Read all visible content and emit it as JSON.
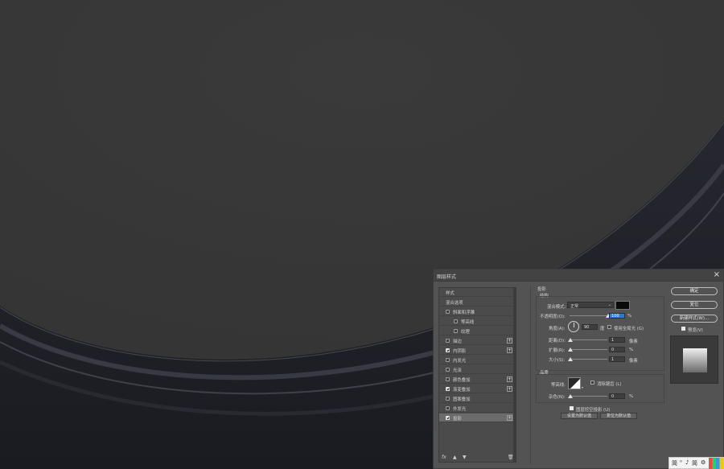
{
  "dialog": {
    "title": "图层样式",
    "close_label": "×"
  },
  "style_list": {
    "items": [
      {
        "label": "样式",
        "checkbox": false,
        "checked": false,
        "plus": false,
        "indent": 0
      },
      {
        "label": "混合选项",
        "checkbox": false,
        "checked": false,
        "plus": false,
        "indent": 0
      },
      {
        "label": "斜面和浮雕",
        "checkbox": true,
        "checked": false,
        "plus": false,
        "indent": 0
      },
      {
        "label": "等高线",
        "checkbox": true,
        "checked": false,
        "plus": false,
        "indent": 1
      },
      {
        "label": "纹理",
        "checkbox": true,
        "checked": false,
        "plus": false,
        "indent": 1
      },
      {
        "label": "描边",
        "checkbox": true,
        "checked": false,
        "plus": true,
        "indent": 0
      },
      {
        "label": "内阴影",
        "checkbox": true,
        "checked": true,
        "plus": true,
        "indent": 0
      },
      {
        "label": "内发光",
        "checkbox": true,
        "checked": false,
        "plus": false,
        "indent": 0
      },
      {
        "label": "光泽",
        "checkbox": true,
        "checked": false,
        "plus": false,
        "indent": 0
      },
      {
        "label": "颜色叠加",
        "checkbox": true,
        "checked": false,
        "plus": true,
        "indent": 0
      },
      {
        "label": "渐变叠加",
        "checkbox": true,
        "checked": true,
        "plus": true,
        "indent": 0
      },
      {
        "label": "图案叠加",
        "checkbox": true,
        "checked": false,
        "plus": false,
        "indent": 0
      },
      {
        "label": "外发光",
        "checkbox": true,
        "checked": false,
        "plus": false,
        "indent": 0
      },
      {
        "label": "投影",
        "checkbox": true,
        "checked": true,
        "plus": true,
        "indent": 0,
        "selected": true
      }
    ],
    "fx_label": "fx",
    "up_icon": "▲",
    "down_icon": "▼",
    "trash_icon": "🗑"
  },
  "panel": {
    "section_title": "投影",
    "structure_title": "结构",
    "blend_mode_label": "混合模式:",
    "blend_mode_value": "正常",
    "opacity_label": "不透明度(O):",
    "opacity_value": "100",
    "opacity_fraction": 1.0,
    "angle_label": "角度(A):",
    "angle_value": "90",
    "angle_unit": "度",
    "global_light_label": "使用全局光 (G)",
    "distance_label": "距离(D):",
    "distance_value": "1",
    "spread_label": "扩展(R):",
    "spread_value": "0",
    "size_label": "大小(S):",
    "size_value": "1",
    "px_unit": "像素",
    "percent_unit": "%",
    "quality_title": "品质",
    "contour_label": "等高线:",
    "anti_alias_label": "消除锯齿 (L)",
    "noise_label": "杂色(N):",
    "noise_value": "0",
    "knockout_label": "图层挖空投影 (U)",
    "set_default_label": "设置为默认值",
    "reset_default_label": "复位为默认值",
    "shadow_color": "#0a0a0a"
  },
  "buttons": {
    "ok": "确定",
    "reset": "复位",
    "new_style": "新建样式(W)...",
    "preview": "预览(V)"
  },
  "ime": {
    "items": [
      "简",
      "⁰",
      "♪",
      "简",
      "⚙"
    ]
  },
  "colors": {
    "canvas_bg": "#3a3a3a",
    "dark_rim": "#1e1f26",
    "dialog_bg": "#535353",
    "highlight": "#2d7bd1"
  }
}
